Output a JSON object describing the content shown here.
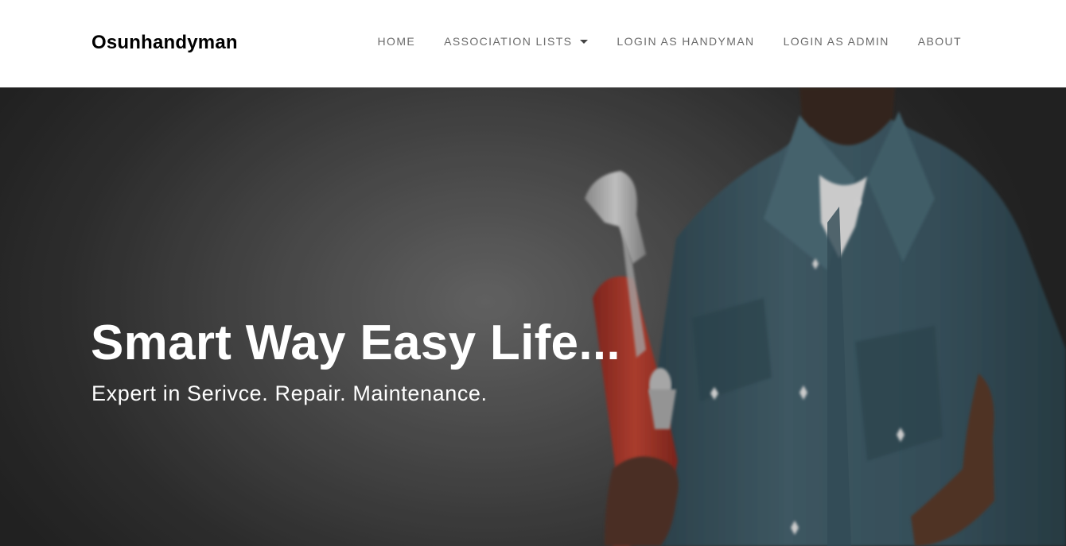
{
  "header": {
    "brand": "Osunhandyman",
    "nav": [
      {
        "label": "HOME"
      },
      {
        "label": "ASSOCIATION LISTS",
        "has_dropdown": true
      },
      {
        "label": "LOGIN AS HANDYMAN"
      },
      {
        "label": "LOGIN AS ADMIN"
      },
      {
        "label": "ABOUT"
      }
    ]
  },
  "hero": {
    "title": "Smart Way Easy Life...",
    "subtitle": "Expert in Serivce. Repair. Maintenance.",
    "image": "handyman-with-pipe-wrench"
  },
  "colors": {
    "nav_text": "#6b6b6b",
    "brand_text": "#000000",
    "shirt": "#3f5c68",
    "wrench": "#b8392c",
    "hero_bg": "#4f4f4f"
  }
}
